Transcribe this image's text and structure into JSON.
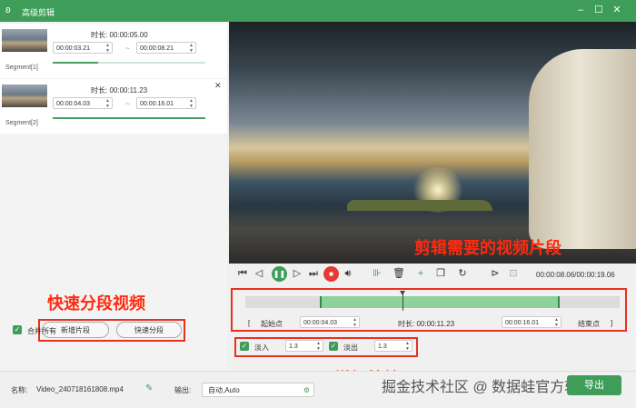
{
  "window": {
    "title": "高级剪辑",
    "logo_icon": "bunny-logo-icon",
    "controls": [
      "minimize-icon",
      "maximize-icon",
      "close-icon"
    ]
  },
  "segments": [
    {
      "name": "Segment[1]",
      "duration_label": "时长: 00:00:05.00",
      "start": "00:00:03.21",
      "end": "00:00:08.21",
      "progress": 0.3
    },
    {
      "name": "Segment[2]",
      "duration_label": "时长: 00:00:11.23",
      "start": "00:00:04.03",
      "end": "00:00:16.01",
      "progress": 1.0
    }
  ],
  "range_separator": "~",
  "left_panel": {
    "add_segment": "新增片段",
    "quick_split": "快速分段",
    "merge_all": "合并所有",
    "merge_checked": true
  },
  "controls": {
    "timecode": "00:00:08.06/00:00:19.06"
  },
  "range": {
    "start_label": "起始点",
    "start": "00:00:04.03",
    "duration": "时长: 00:00:11.23",
    "end": "00:00:16.01",
    "end_label": "结束点",
    "open_bracket": "[",
    "close_bracket": "]",
    "sel_start_fraction": 0.2,
    "sel_end_fraction": 0.84,
    "playhead_fraction": 0.42
  },
  "effects": {
    "fade_in_label": "淡入",
    "fade_in_value": "1.3",
    "fade_out_label": "淡出",
    "fade_out_value": "1.3",
    "fade_in_checked": true,
    "fade_out_checked": true
  },
  "footer": {
    "name_label": "名称:",
    "file_name": "Video_240718161808.mp4",
    "output_label": "输出:",
    "output_value": "自动,Auto",
    "export": "导出"
  },
  "annotations": {
    "video": "剪辑需要的视频片段",
    "split": "快速分段视频",
    "effects": "增加特效"
  },
  "watermark": "掘金技术社区 @ 数据蛙官方软件",
  "colors": {
    "accent": "#3f9d5a",
    "annotation": "#e8321e",
    "stop": "#e53935"
  }
}
